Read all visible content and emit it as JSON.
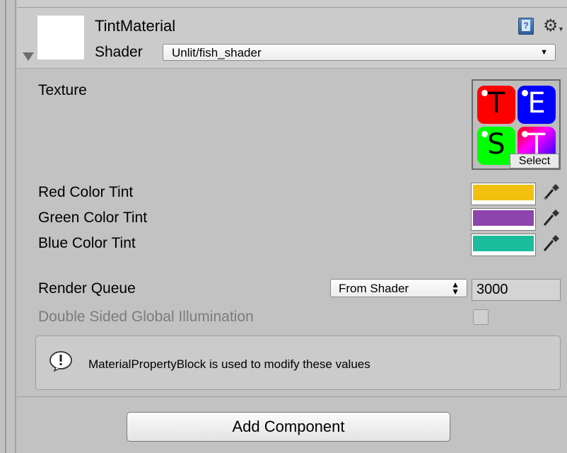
{
  "header": {
    "title": "TintMaterial",
    "shader_label": "Shader",
    "shader_value": "Unlit/fish_shader"
  },
  "texture": {
    "label": "Texture",
    "select_label": "Select",
    "tiles": [
      "T",
      "E",
      "S",
      "T"
    ]
  },
  "tints": [
    {
      "label": "Red Color Tint",
      "color": "#f2c00f"
    },
    {
      "label": "Green Color Tint",
      "color": "#8e44ad"
    },
    {
      "label": "Blue Color Tint",
      "color": "#1abc9c"
    }
  ],
  "render_queue": {
    "label": "Render Queue",
    "dropdown_value": "From Shader",
    "value": "3000"
  },
  "double_sided": {
    "label": "Double Sided Global Illumination",
    "checked": false
  },
  "info": {
    "message": "MaterialPropertyBlock is used to modify these values"
  },
  "add_component_label": "Add Component"
}
